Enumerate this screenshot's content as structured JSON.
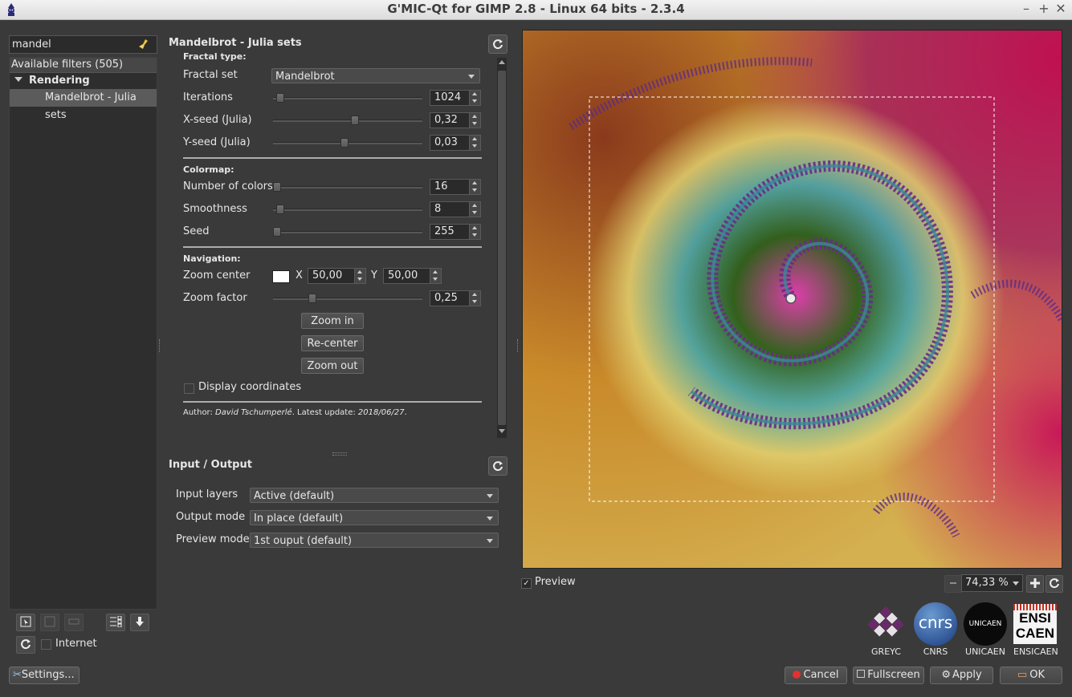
{
  "window": {
    "title": "G'MIC-Qt for GIMP 2.8 - Linux 64 bits - 2.3.4"
  },
  "filters": {
    "search_value": "mandel",
    "header": "Available filters (505)",
    "category": "Rendering",
    "selected_filter": "Mandelbrot - Julia sets",
    "internet_label": "Internet",
    "settings_label": "Settings..."
  },
  "filter": {
    "title": "Mandelbrot - Julia sets",
    "section_fractal_type": "Fractal type:",
    "fractal_set": {
      "label": "Fractal set",
      "value": "Mandelbrot"
    },
    "iterations": {
      "label": "Iterations",
      "value": "1024",
      "fraction": 0.02
    },
    "xseed": {
      "label": "X-seed (Julia)",
      "value": "0,32",
      "fraction": 0.55
    },
    "yseed": {
      "label": "Y-seed (Julia)",
      "value": "0,03",
      "fraction": 0.48
    },
    "section_colormap": "Colormap:",
    "colors": {
      "label": "Number of colors",
      "value": "16",
      "fraction": 0.0
    },
    "smoothness": {
      "label": "Smoothness",
      "value": "8",
      "fraction": 0.02
    },
    "seed": {
      "label": "Seed",
      "value": "255",
      "fraction": 0.0
    },
    "section_navigation": "Navigation:",
    "zoom_center": {
      "label": "Zoom center",
      "x_label": "X",
      "x_value": "50,00",
      "y_label": "Y",
      "y_value": "50,00",
      "color": "#ffffff"
    },
    "zoom_factor": {
      "label": "Zoom factor",
      "value": "0,25",
      "fraction": 0.25
    },
    "zoom_in": "Zoom in",
    "recenter": "Re-center",
    "zoom_out": "Zoom out",
    "display_coordinates": "Display coordinates",
    "author_prefix": "Author: ",
    "author_name": "David Tschumperlé",
    "update_prefix": ". Latest update: ",
    "update_date": "2018/06/27",
    "author_suffix": "."
  },
  "io": {
    "title": "Input / Output",
    "input_layers": {
      "label": "Input layers",
      "value": "Active (default)"
    },
    "output_mode": {
      "label": "Output mode",
      "value": "In place (default)"
    },
    "preview_mode": {
      "label": "Preview mode",
      "value": "1st ouput (default)"
    }
  },
  "preview": {
    "checkbox_label": "Preview",
    "checked": true,
    "zoom": "74,33 %"
  },
  "logos": [
    {
      "text": "GREYC"
    },
    {
      "text": "CNRS"
    },
    {
      "text": "UNICAEN"
    },
    {
      "text": "ENSICAEN"
    }
  ],
  "logo_marks": {
    "cnrs": "cnrs",
    "unicaen": "UNICAEN",
    "ensi1": "ENSI",
    "ensi2": "CAEN"
  },
  "buttons": {
    "cancel": "Cancel",
    "fullscreen": "Fullscreen",
    "apply": "Apply",
    "ok": "OK"
  },
  "colors": {
    "accent_cancel": "#e43030",
    "background": "#3a3a3a"
  }
}
